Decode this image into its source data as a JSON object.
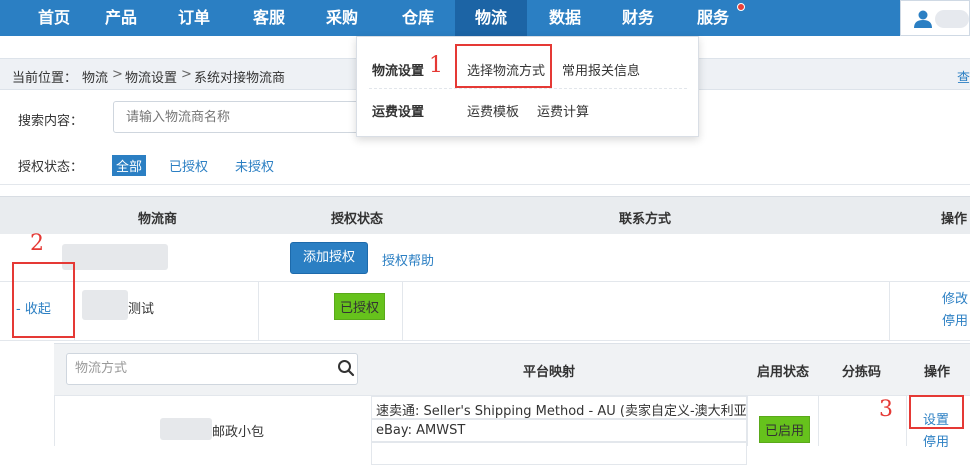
{
  "nav": {
    "items": [
      "首页",
      "产品",
      "订单",
      "客服",
      "采购",
      "仓库",
      "物流",
      "数据",
      "财务",
      "服务"
    ],
    "active": "物流"
  },
  "breadcrumb": {
    "prefix": "当前位置：",
    "level1": "物流",
    "level2": "物流设置",
    "level3": "系统对接物流商",
    "sep": ">",
    "right_link": "查"
  },
  "search": {
    "label": "搜索内容：",
    "placeholder": "请输入物流商名称",
    "auth_label": "授权状态：",
    "filters": [
      "全部",
      "已授权",
      "未授权"
    ]
  },
  "dropdown": {
    "group1_title": "物流设置",
    "group1_links": [
      "选择物流方式",
      "常用报关信息"
    ],
    "group2_title": "运费设置",
    "group2_links": [
      "运费模板",
      "运费计算"
    ]
  },
  "table": {
    "headers": [
      "物流商",
      "授权状态",
      "联系方式",
      "操作"
    ],
    "add_auth_button": "添加授权",
    "auth_help_link": "授权帮助",
    "collapse_link": "收起",
    "row_name_suffix": "测试",
    "status_badge": "已授权",
    "actions": [
      "修改",
      "停用"
    ]
  },
  "subtable": {
    "search_placeholder": "物流方式",
    "headers": [
      "平台映射",
      "启用状态",
      "分拣码",
      "操作"
    ],
    "row_name_suffix": "邮政小包",
    "mappings": [
      "速卖通:   Seller's Shipping Method - AU (卖家自定义-澳大利亚)",
      "eBay:   AMWST"
    ],
    "status_badge": "已启用",
    "actions": [
      "设置",
      "停用"
    ]
  },
  "annotations": [
    "1",
    "2",
    "3"
  ],
  "colors": {
    "nav_bg": "#2b7fc3",
    "nav_active": "#1c64a5",
    "link": "#2b7fc3",
    "badge_green": "#66c21c",
    "annotation_red": "#e53935"
  }
}
